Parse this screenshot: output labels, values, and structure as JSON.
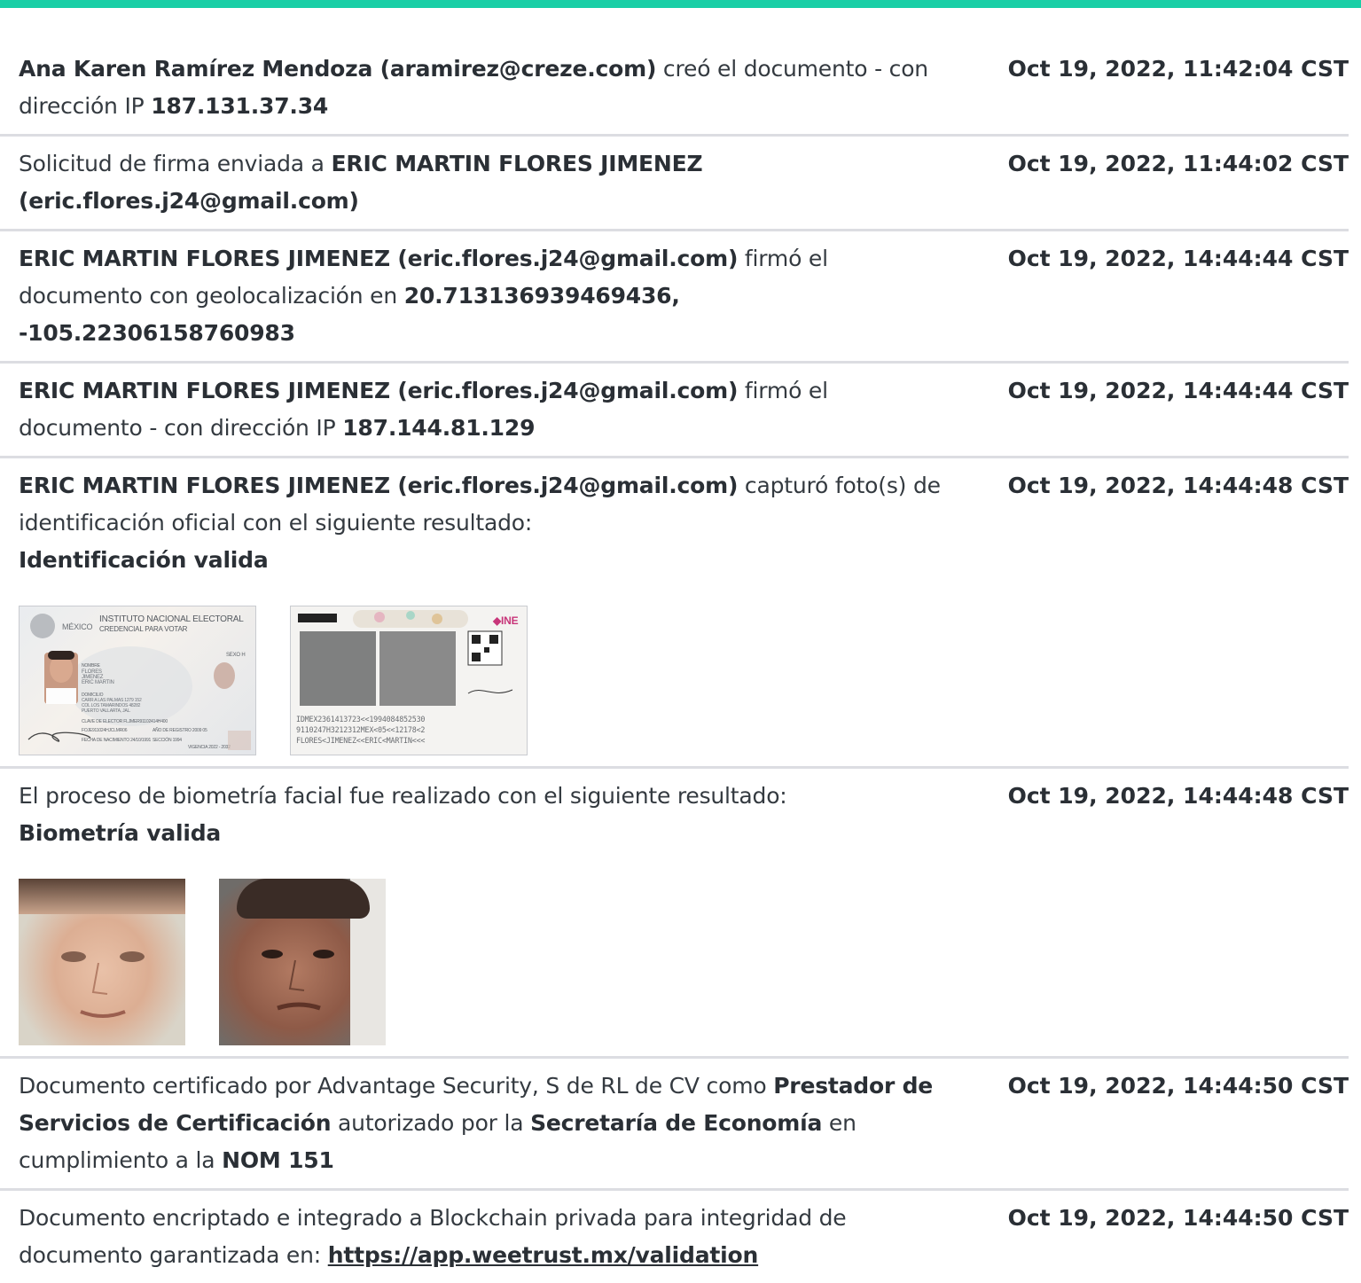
{
  "colors": {
    "accent_bar": "#19cfa6",
    "divider": "#dcdde2"
  },
  "events": [
    {
      "parts": [
        {
          "t": "Ana Karen Ramírez Mendoza (aramirez@creze.com)",
          "b": true
        },
        {
          "t": " creó el documento - con dirección IP "
        },
        {
          "t": "187.131.37.34",
          "b": true
        }
      ],
      "date": "Oct 19, 2022, 11:42:04 CST"
    },
    {
      "parts": [
        {
          "t": "Solicitud de firma enviada a "
        },
        {
          "t": "ERIC MARTIN FLORES JIMENEZ (eric.flores.j24@gmail.com)",
          "b": true
        }
      ],
      "date": "Oct 19, 2022, 11:44:02 CST"
    },
    {
      "parts": [
        {
          "t": "ERIC MARTIN FLORES JIMENEZ (eric.flores.j24@gmail.com)",
          "b": true
        },
        {
          "t": " firmó el documento con geolocalización en "
        },
        {
          "t": "20.713136939469436, -105.22306158760983",
          "b": true
        }
      ],
      "date": "Oct 19, 2022, 14:44:44 CST"
    },
    {
      "parts": [
        {
          "t": "ERIC MARTIN FLORES JIMENEZ (eric.flores.j24@gmail.com)",
          "b": true
        },
        {
          "t": " firmó el documento - con dirección IP "
        },
        {
          "t": "187.144.81.129",
          "b": true
        }
      ],
      "date": "Oct 19, 2022, 14:44:44 CST"
    },
    {
      "parts": [
        {
          "t": "ERIC MARTIN FLORES JIMENEZ (eric.flores.j24@gmail.com)",
          "b": true
        },
        {
          "t": " capturó foto(s) de identificación oficial con el siguiente resultado:"
        },
        {
          "t": "BR"
        },
        {
          "t": "Identificación valida",
          "b": true
        }
      ],
      "date": "Oct 19, 2022, 14:44:48 CST",
      "images": "id"
    },
    {
      "parts": [
        {
          "t": "El proceso de biometría facial fue realizado con el siguiente resultado:"
        },
        {
          "t": "BR"
        },
        {
          "t": "Biometría valida",
          "b": true
        }
      ],
      "date": "Oct 19, 2022, 14:44:48 CST",
      "images": "faces"
    },
    {
      "parts": [
        {
          "t": "Documento certificado por Advantage Security, S de RL de CV como "
        },
        {
          "t": "Prestador de Servicios de Certificación",
          "b": true
        },
        {
          "t": " autorizado por la "
        },
        {
          "t": "Secretaría de Economía",
          "b": true
        },
        {
          "t": " en cumplimiento a la "
        },
        {
          "t": "NOM 151",
          "b": true
        }
      ],
      "date": "Oct 19, 2022, 14:44:50 CST"
    },
    {
      "parts": [
        {
          "t": "Documento encriptado e integrado a Blockchain privada para integridad de documento garantizada en: "
        },
        {
          "t": "https://app.weetrust.mx/validation",
          "link": true
        }
      ],
      "date": "Oct 19, 2022, 14:44:50 CST"
    }
  ],
  "id_card": {
    "front": {
      "country": "MÉXICO",
      "institute": "INSTITUTO NACIONAL ELECTORAL",
      "card_title": "CREDENCIAL PARA VOTAR",
      "name_label": "NOMBRE",
      "name_lines": [
        "FLORES",
        "JIMENEZ",
        "ERIC MARTIN"
      ],
      "sex": "SEXO H",
      "address_label": "DOMICILIO",
      "address_lines": [
        "CARR A LAS PALMAS 1279 152",
        "COL LOS TAMARINDOS 48282",
        "PUERTO VALLARTA, JAL."
      ],
      "elector": "CLAVE DE ELECTOR  FLJMER91102414H400",
      "curp": "FOJE911024HJCLMR06",
      "registro": "AÑO DE REGISTRO 2009 05",
      "nacimiento": "FECHA DE NACIMIENTO 24/10/1991",
      "seccion": "SECCIÓN 1994",
      "vigencia": "VIGENCIA 2022 - 2032"
    },
    "back": {
      "brand": "◆INE",
      "mrz": [
        "IDMEX2361413723<<1994084852530",
        "9110247H3212312MEX<05<<12178<2",
        "FLORES<JIMENEZ<<ERIC<MARTIN<<<"
      ]
    }
  }
}
